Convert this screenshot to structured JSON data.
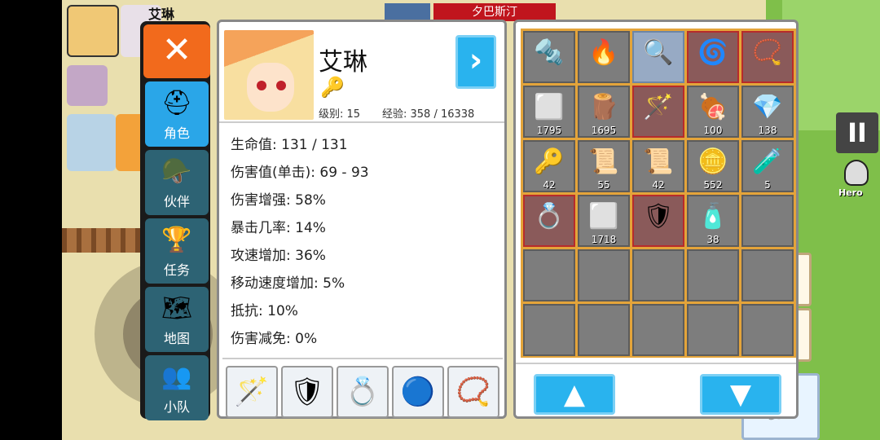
{
  "world": {
    "top_name": "夕巴斯汀",
    "player_tag": "艾琳",
    "pause_label": "II",
    "hero_label": "Hero"
  },
  "tabs": [
    {
      "label": "角色",
      "icon": "knight-helmet-icon",
      "glyph": "⛑",
      "active": true
    },
    {
      "label": "伙伴",
      "icon": "viking-helmet-icon",
      "glyph": "🪖",
      "active": false
    },
    {
      "label": "任务",
      "icon": "trophy-icon",
      "glyph": "🏆",
      "active": false
    },
    {
      "label": "地图",
      "icon": "map-icon",
      "glyph": "🗺",
      "active": false
    },
    {
      "label": "小队",
      "icon": "party-icon",
      "glyph": "👥",
      "active": false
    }
  ],
  "close_label": "✕",
  "character": {
    "name": "艾琳",
    "level_text": "级别: 15",
    "exp_text": "经验: 358 / 16338",
    "next_label": "›",
    "stats": [
      "生命值: 131 / 131",
      "伤害值(单击): 69 - 93",
      "伤害增强: 58%",
      "暴击几率: 14%",
      "攻速增加: 36%",
      "移动速度增加: 5%",
      "抵抗: 10%",
      "伤害减免: 0%"
    ],
    "equipment": [
      {
        "icon": "ruby-staff-icon",
        "glyph": "🪄"
      },
      {
        "icon": "blue-armor-icon",
        "glyph": "🛡"
      },
      {
        "icon": "flower-ring-icon",
        "glyph": "💍"
      },
      {
        "icon": "blue-ring-icon",
        "glyph": "🔵"
      },
      {
        "icon": "pendant-icon",
        "glyph": "📿"
      }
    ]
  },
  "inventory": {
    "slots": [
      {
        "icon": "drill-potion-icon",
        "glyph": "🔩",
        "count": "",
        "style": "normal"
      },
      {
        "icon": "fire-scroll-icon",
        "glyph": "🔥",
        "count": "",
        "style": "normal"
      },
      {
        "icon": "magnifier-staff-icon",
        "glyph": "🔍",
        "count": "",
        "style": "blue"
      },
      {
        "icon": "ghost-ring-icon",
        "glyph": "🌀",
        "count": "",
        "style": "rare"
      },
      {
        "icon": "pendant-icon",
        "glyph": "📿",
        "count": "",
        "style": "rare"
      },
      {
        "icon": "iron-ingot-icon",
        "glyph": "⬜",
        "count": "1795",
        "style": "normal"
      },
      {
        "icon": "wood-logs-icon",
        "glyph": "🪵",
        "count": "1695",
        "style": "normal"
      },
      {
        "icon": "ruby-staff-icon",
        "glyph": "🪄",
        "count": "",
        "style": "rare"
      },
      {
        "icon": "meat-icon",
        "glyph": "🍖",
        "count": "100",
        "style": "normal"
      },
      {
        "icon": "red-crystal-icon",
        "glyph": "💎",
        "count": "138",
        "style": "normal"
      },
      {
        "icon": "key-icon",
        "glyph": "🔑",
        "count": "42",
        "style": "normal"
      },
      {
        "icon": "blue-scroll-icon",
        "glyph": "📜",
        "count": "55",
        "style": "normal"
      },
      {
        "icon": "red-scroll-icon",
        "glyph": "📜",
        "count": "42",
        "style": "normal"
      },
      {
        "icon": "gold-coins-icon",
        "glyph": "🪙",
        "count": "552",
        "style": "normal"
      },
      {
        "icon": "red-vial-icon",
        "glyph": "🧪",
        "count": "5",
        "style": "normal"
      },
      {
        "icon": "flower-ring-icon",
        "glyph": "💍",
        "count": "",
        "style": "rare"
      },
      {
        "icon": "silver-ingot-icon",
        "glyph": "⬜",
        "count": "1718",
        "style": "normal"
      },
      {
        "icon": "blue-armor-icon",
        "glyph": "🛡",
        "count": "",
        "style": "rare"
      },
      {
        "icon": "health-potion-icon",
        "glyph": "🧴",
        "count": "38",
        "style": "normal"
      },
      {
        "icon": "",
        "glyph": "",
        "count": "",
        "style": "normal"
      },
      {
        "icon": "",
        "glyph": "",
        "count": "",
        "style": "normal"
      },
      {
        "icon": "",
        "glyph": "",
        "count": "",
        "style": "normal"
      },
      {
        "icon": "",
        "glyph": "",
        "count": "",
        "style": "normal"
      },
      {
        "icon": "",
        "glyph": "",
        "count": "",
        "style": "normal"
      },
      {
        "icon": "",
        "glyph": "",
        "count": "",
        "style": "normal"
      },
      {
        "icon": "",
        "glyph": "",
        "count": "",
        "style": "normal"
      },
      {
        "icon": "",
        "glyph": "",
        "count": "",
        "style": "normal"
      },
      {
        "icon": "",
        "glyph": "",
        "count": "",
        "style": "normal"
      },
      {
        "icon": "",
        "glyph": "",
        "count": "",
        "style": "normal"
      },
      {
        "icon": "",
        "glyph": "",
        "count": "",
        "style": "normal"
      }
    ],
    "up_label": "▲",
    "down_label": "▼"
  },
  "quick_slots": [
    {
      "icon": "ruby-staff-icon",
      "glyph": "🪄"
    },
    {
      "icon": "magnifier-staff-icon",
      "glyph": "🔍"
    },
    {
      "icon": "ice-wing-icon",
      "glyph": "🪽"
    }
  ],
  "colors": {
    "accent": "#29b3ee",
    "close": "#f26a1c",
    "inventory_frame": "#e4a43a",
    "tab_active": "#2aa6e8",
    "tab_inactive": "#2d6374"
  }
}
